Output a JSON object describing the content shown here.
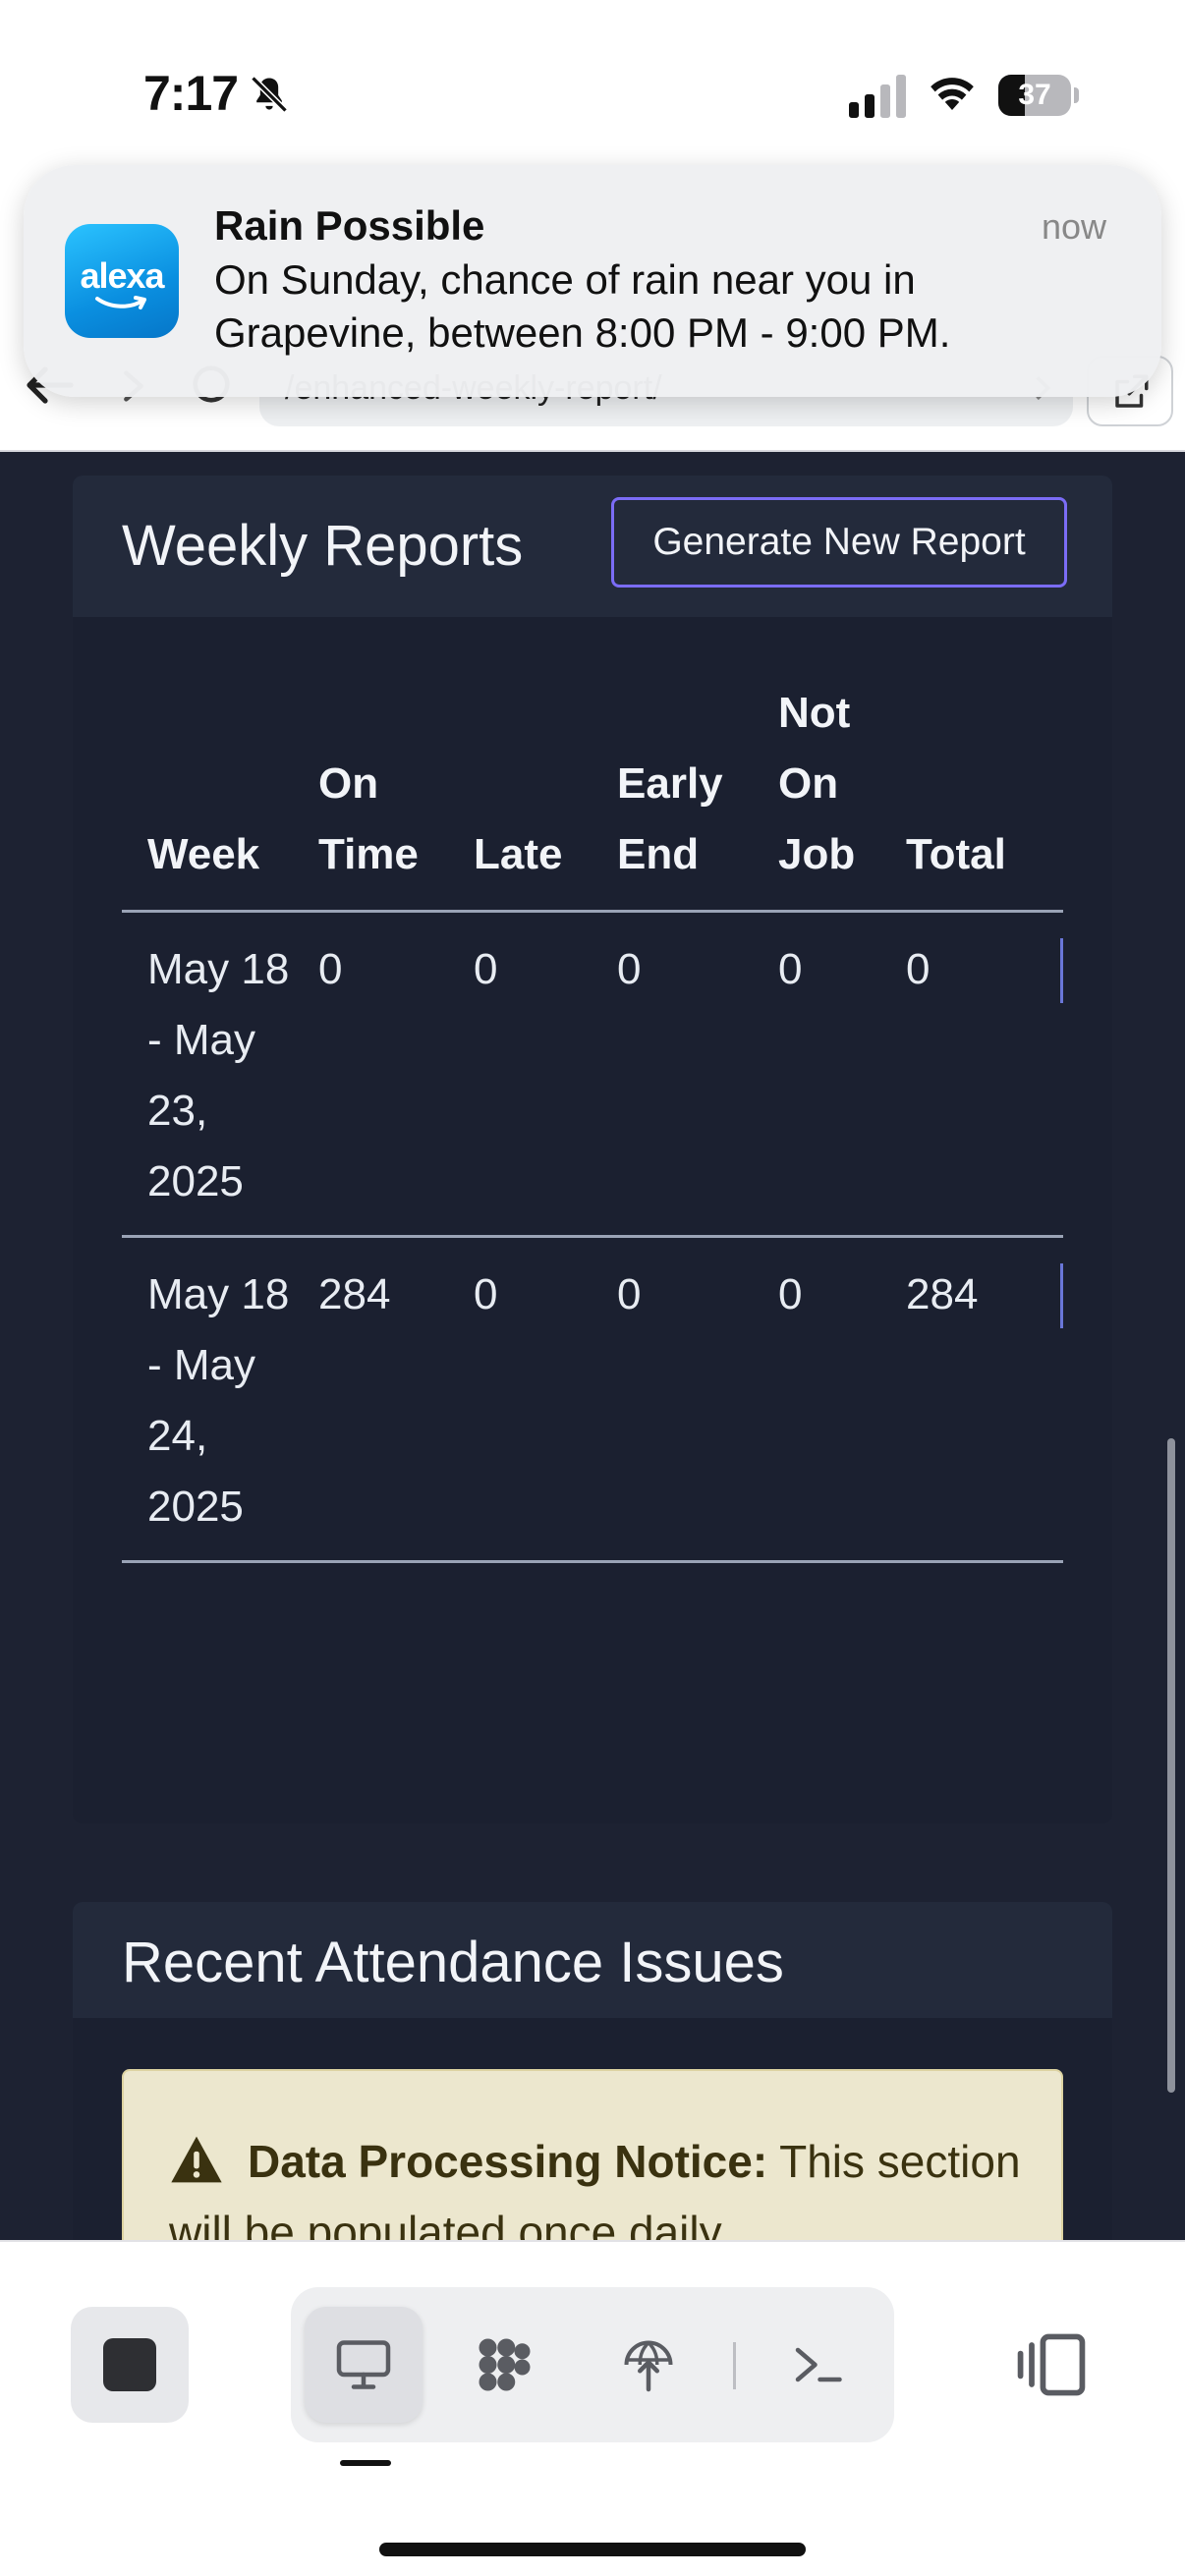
{
  "status_bar": {
    "time": "7:17",
    "battery": "37",
    "battery_level": 0.37
  },
  "notification": {
    "app_icon_label": "alexa",
    "title": "Rain Possible",
    "time": "now",
    "body": "On Sunday, chance of rain near you in Grapevine, between 8:00 PM - 9:00 PM."
  },
  "browser": {
    "url": "/enhanced-weekly-report/"
  },
  "weekly_reports": {
    "title": "Weekly Reports",
    "generate_button": "Generate New Report",
    "columns": {
      "week": "Week",
      "on_time": "On Time",
      "late": "Late",
      "early_end": "Early End",
      "not_on_job": "Not On Job",
      "total": "Total"
    },
    "rows": [
      {
        "week": "May 18 - May 23, 2025",
        "on_time": "0",
        "late": "0",
        "early_end": "0",
        "not_on_job": "0",
        "total": "0"
      },
      {
        "week": "May 18 - May 24, 2025",
        "on_time": "284",
        "late": "0",
        "early_end": "0",
        "not_on_job": "0",
        "total": "284"
      }
    ]
  },
  "attendance_issues": {
    "title": "Recent Attendance Issues",
    "notice_label": "Data Processing Notice:",
    "notice_text": " This section will be populated once daily"
  },
  "colors": {
    "page_bg": "#1d2232",
    "accent_button_border": "#7b6cf6",
    "on_time": "#5cc66f",
    "late": "#b7901a",
    "early_end": "#36b6d8",
    "not_on_job": "#ef5f66",
    "notice_bg": "#ece7ce"
  }
}
